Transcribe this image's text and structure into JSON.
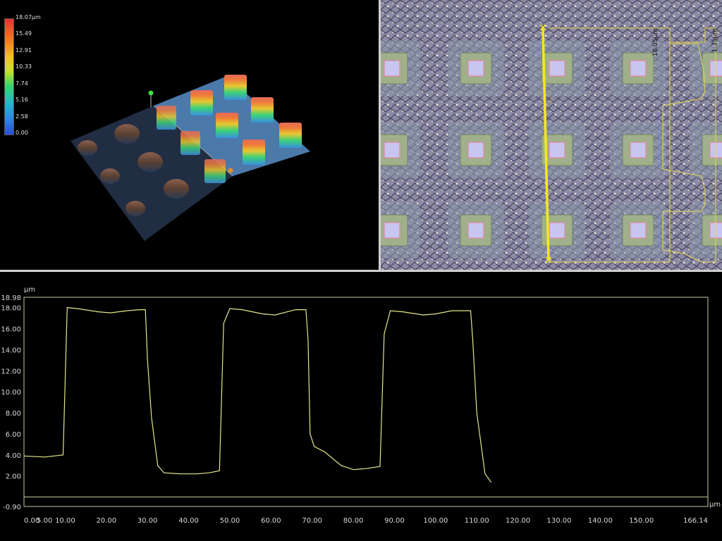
{
  "view3d": {
    "color_scale": {
      "max_label": "18.07μm",
      "labels": [
        "15.49",
        "12.91",
        "10.33",
        "7.74",
        "5.16",
        "2.58",
        "0.00"
      ]
    }
  },
  "camera_view": {
    "marker_length": "18.05μm",
    "marker_height": "1.35μm"
  },
  "profile": {
    "y_unit": "μm",
    "x_unit": "μm",
    "y_top_label": "18.98",
    "y_bottom_label": "-0.90",
    "y_ticks": [
      "18.00",
      "16.00",
      "14.00",
      "12.00",
      "10.00",
      "8.00",
      "6.00",
      "4.00",
      "2.00"
    ],
    "x_ticks": [
      "0.00",
      "5.00",
      "10.00",
      "20.00",
      "30.00",
      "40.00",
      "50.00",
      "60.00",
      "70.00",
      "80.00",
      "90.00",
      "100.00",
      "110.00",
      "120.00",
      "130.00",
      "140.00",
      "150.00"
    ],
    "x_end_label": "166.14",
    "line_color": "#e6e68c"
  },
  "chart_data": {
    "type": "line",
    "xlabel": "μm",
    "ylabel": "μm",
    "xlim": [
      0,
      166.14
    ],
    "ylim": [
      -0.9,
      18.98
    ],
    "x": [
      0,
      5,
      9.5,
      10.5,
      13,
      18,
      21,
      25,
      28,
      29.5,
      30,
      31,
      32.5,
      34,
      38,
      42,
      45,
      47.5,
      48.5,
      50,
      53,
      58,
      61,
      66,
      68.5,
      69,
      69.5,
      70.5,
      73,
      77,
      80,
      83,
      86.5,
      87.5,
      89,
      92,
      97,
      100,
      104,
      107,
      108.5,
      109,
      110,
      112,
      113.5
    ],
    "y": [
      3.9,
      3.8,
      4.0,
      18.0,
      17.9,
      17.6,
      17.5,
      17.7,
      17.8,
      17.8,
      13,
      7.5,
      3.0,
      2.3,
      2.2,
      2.2,
      2.3,
      2.5,
      16.5,
      17.9,
      17.8,
      17.4,
      17.3,
      17.8,
      17.8,
      15,
      6,
      4.8,
      4.3,
      3.0,
      2.6,
      2.7,
      2.9,
      15.5,
      17.7,
      17.6,
      17.3,
      17.4,
      17.7,
      17.7,
      17.7,
      15,
      8,
      2.2,
      1.4
    ]
  }
}
